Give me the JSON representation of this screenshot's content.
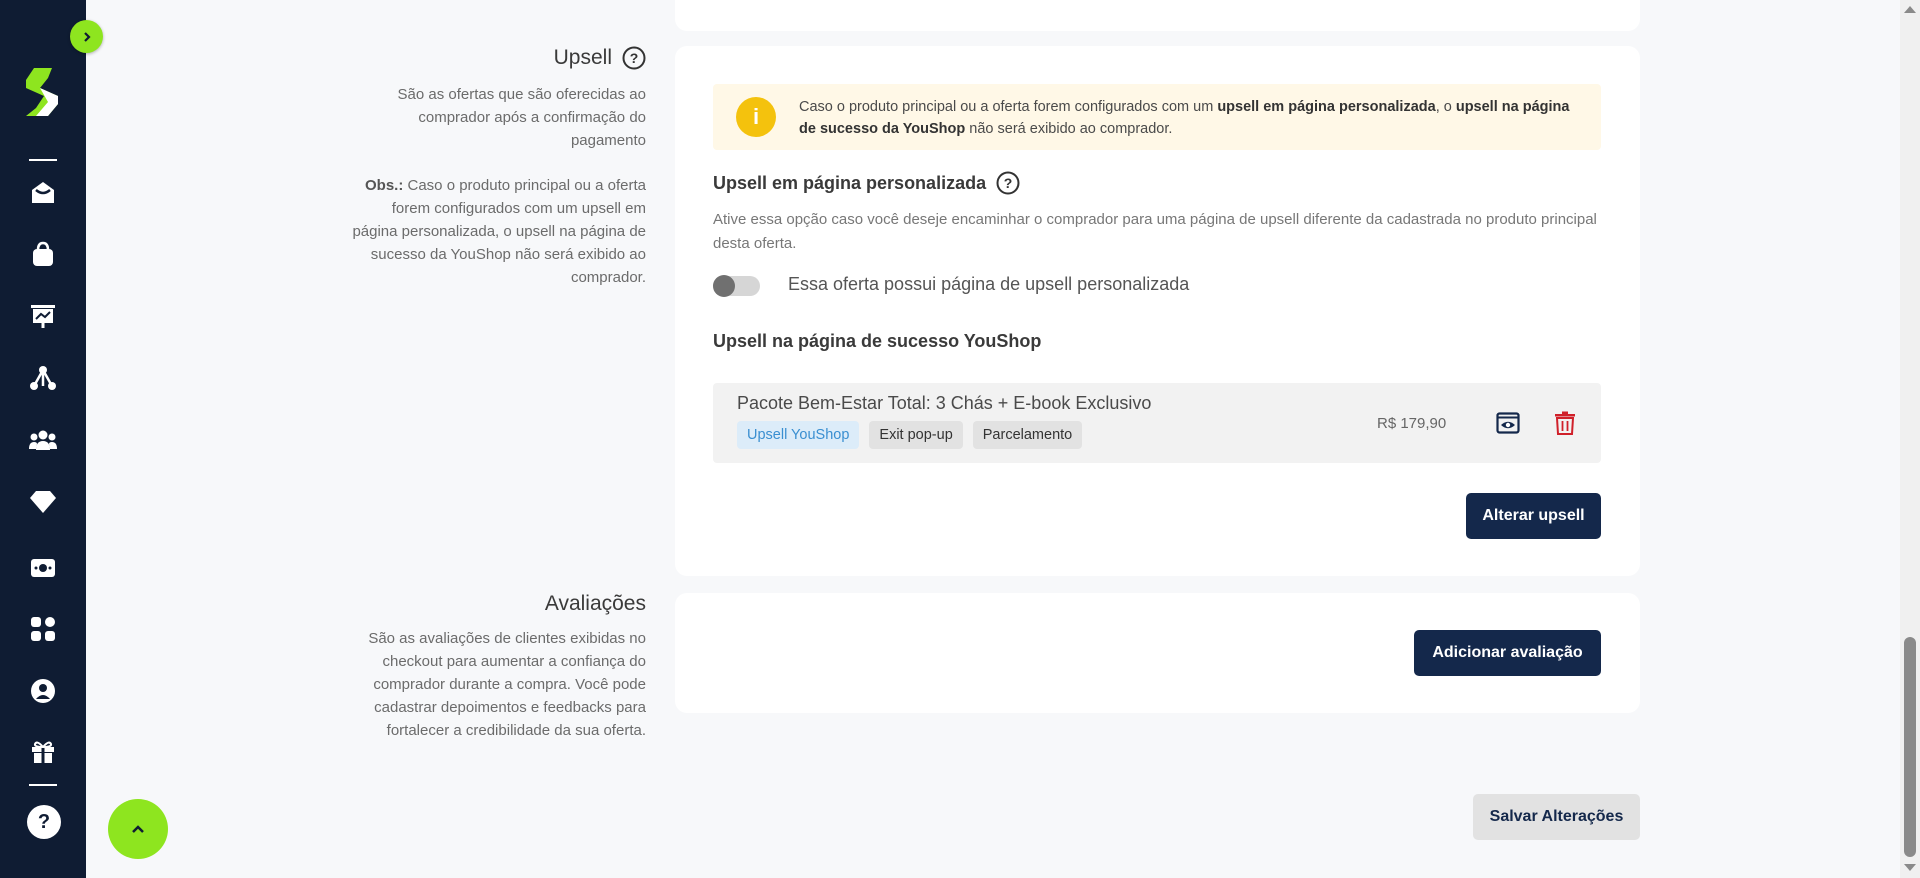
{
  "sidebar": {
    "toggle_icon": "chevron-right-icon",
    "logo": "youshop-s-logo",
    "items": [
      {
        "icon": "home-icon"
      },
      {
        "icon": "shopping-bag-icon"
      },
      {
        "icon": "presentation-chart-icon"
      },
      {
        "icon": "network-icon"
      },
      {
        "icon": "users-icon"
      },
      {
        "icon": "diamond-icon"
      },
      {
        "icon": "money-icon"
      },
      {
        "icon": "apps-grid-icon"
      },
      {
        "icon": "user-circle-icon"
      },
      {
        "icon": "gift-icon"
      }
    ],
    "help_icon_glyph": "?"
  },
  "upsell_section": {
    "title": "Upsell",
    "description": "São as ofertas que são oferecidas ao comprador após a confirmação do pagamento",
    "obs_label": "Obs.:",
    "obs_text": " Caso o produto principal ou a oferta forem configurados com um upsell em página personalizada, o upsell na página de sucesso da YouShop não será exibido ao comprador.",
    "alert": {
      "icon_glyph": "i",
      "text_1": "Caso o produto principal ou a oferta forem configurados com um ",
      "bold_1": "upsell em página personalizada",
      "text_2": ", o ",
      "bold_2": "upsell na página de sucesso da YouShop",
      "text_3": " não será exibido ao comprador."
    },
    "custom_page": {
      "title": "Upsell em página personalizada",
      "description": "Ative essa opção caso você deseje encaminhar o comprador para uma página de upsell diferente da cadastrada no produto principal desta oferta.",
      "toggle_label": "Essa oferta possui página de upsell personalizada",
      "toggle_on": false
    },
    "success_page": {
      "title": "Upsell na página de sucesso YouShop",
      "item": {
        "title": "Pacote Bem-Estar Total: 3 Chás + E-book Exclusivo",
        "tags": [
          "Upsell YouShop",
          "Exit pop-up",
          "Parcelamento"
        ],
        "price": "R$ 179,90"
      }
    },
    "change_button": "Alterar upsell"
  },
  "reviews_section": {
    "title": "Avaliações",
    "description": "São as avaliações de clientes exibidas no checkout para aumentar a confiança do comprador durante a compra. Você pode cadastrar depoimentos e feedbacks para fortalecer a credibilidade da sua oferta.",
    "add_button": "Adicionar avaliação"
  },
  "footer": {
    "save_button": "Salvar Alterações"
  },
  "colors": {
    "sidebar_bg": "#0f1c33",
    "accent_green": "#8ee51f",
    "primary_button": "#14284b",
    "alert_bg": "#fff8e7",
    "alert_icon": "#f4c20d",
    "delete_red": "#d0202a"
  }
}
